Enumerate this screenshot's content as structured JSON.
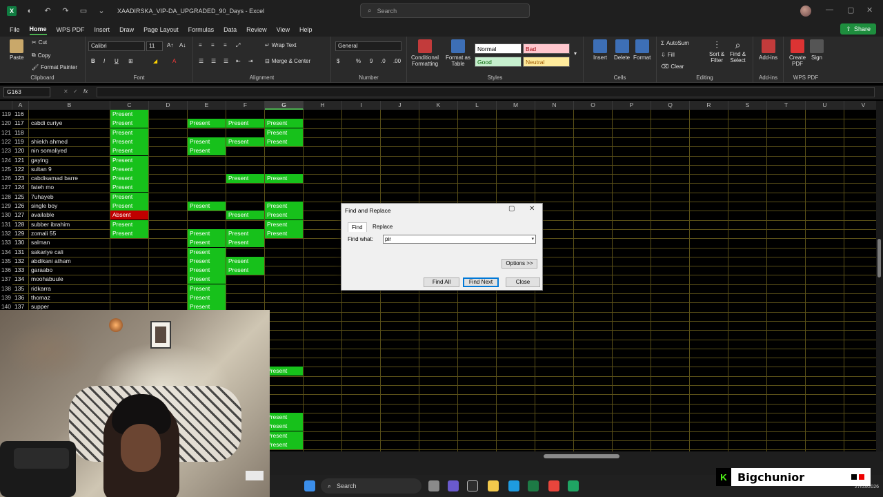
{
  "window": {
    "title": "XAADIRSKA_VIP-DA_UPGRADED_90_Days - Excel",
    "search_placeholder": "Search"
  },
  "menu": [
    "File",
    "Home",
    "WPS PDF",
    "Insert",
    "Draw",
    "Page Layout",
    "Formulas",
    "Data",
    "Review",
    "View",
    "Help"
  ],
  "active_menu": "Home",
  "share_label": "Share",
  "ribbon": {
    "clipboard": {
      "paste": "Paste",
      "cut": "Cut",
      "copy": "Copy",
      "format_painter": "Format Painter",
      "label": "Clipboard"
    },
    "font": {
      "name": "Calibri",
      "size": "11",
      "bold": "B",
      "italic": "I",
      "underline": "U",
      "label": "Font"
    },
    "alignment": {
      "wrap_text": "Wrap Text",
      "merge_center": "Merge & Center",
      "label": "Alignment"
    },
    "number": {
      "format": "General",
      "percent": "%",
      "comma": "9",
      "label": "Number"
    },
    "styles": {
      "conditional": [
        "Conditional",
        "Formatting"
      ],
      "format_as_table": [
        "Format as",
        "Table"
      ],
      "normal": "Normal",
      "bad": "Bad",
      "good": "Good",
      "neutral": "Neutral",
      "label": "Styles"
    },
    "cells": {
      "insert": "Insert",
      "delete": "Delete",
      "format": "Format",
      "label": "Cells"
    },
    "editing": {
      "autosum": "AutoSum",
      "fill": "Fill",
      "clear": "Clear",
      "sort_filter": [
        "Sort &",
        "Filter"
      ],
      "find_select": [
        "Find &",
        "Select"
      ],
      "label": "Editing"
    },
    "addins": {
      "addins": "Add-ins",
      "label": "Add-ins"
    },
    "wps": {
      "create_pdf": [
        "Create",
        "PDF"
      ],
      "sign": "Sign",
      "label": "WPS PDF"
    }
  },
  "formula_bar": {
    "name_box": "G163",
    "fx": "fx"
  },
  "columns": [
    "A",
    "B",
    "C",
    "D",
    "E",
    "F",
    "G",
    "H",
    "I",
    "J",
    "K",
    "L",
    "M",
    "N",
    "O",
    "P",
    "Q",
    "R",
    "S",
    "T",
    "U",
    "V"
  ],
  "selected_column": "G",
  "rows": [
    {
      "row": "119",
      "a": "116",
      "b": "",
      "c": "Present",
      "e": "",
      "f": "",
      "g": ""
    },
    {
      "row": "120",
      "a": "117",
      "b": "cabdi curiye",
      "c": "Present",
      "e": "Present",
      "f": "Present",
      "g": "Present"
    },
    {
      "row": "121",
      "a": "118",
      "b": "",
      "c": "Present",
      "e": "",
      "f": "",
      "g": "Present"
    },
    {
      "row": "122",
      "a": "119",
      "b": "shiekh ahmed",
      "c": "Present",
      "e": "Present",
      "f": "Present",
      "g": "Present"
    },
    {
      "row": "123",
      "a": "120",
      "b": "nin somaliyed",
      "c": "Present",
      "e": "Present",
      "f": "",
      "g": ""
    },
    {
      "row": "124",
      "a": "121",
      "b": "gaying",
      "c": "Present",
      "e": "",
      "f": "",
      "g": ""
    },
    {
      "row": "125",
      "a": "122",
      "b": "sultan 9",
      "c": "Present",
      "e": "",
      "f": "",
      "g": ""
    },
    {
      "row": "126",
      "a": "123",
      "b": "cabdisamad barre",
      "c": "Present",
      "e": "",
      "f": "Present",
      "g": "Present"
    },
    {
      "row": "127",
      "a": "124",
      "b": "fateh mo",
      "c": "Present",
      "e": "",
      "f": "",
      "g": ""
    },
    {
      "row": "128",
      "a": "125",
      "b": "7uhayeb",
      "c": "Present",
      "e": "",
      "f": "",
      "g": ""
    },
    {
      "row": "129",
      "a": "126",
      "b": "single boy",
      "c": "Present",
      "e": "Present",
      "f": "",
      "g": "Present"
    },
    {
      "row": "130",
      "a": "127",
      "b": "available",
      "c": "Absent",
      "e": "",
      "f": "Present",
      "g": "Present"
    },
    {
      "row": "131",
      "a": "128",
      "b": "subber ibrahim",
      "c": "Present",
      "e": "",
      "f": "",
      "g": "Present"
    },
    {
      "row": "132",
      "a": "129",
      "b": "zomali 55",
      "c": "Present",
      "e": "Present",
      "f": "Present",
      "g": "Present"
    },
    {
      "row": "133",
      "a": "130",
      "b": "salman",
      "c": "",
      "e": "Present",
      "f": "Present",
      "g": ""
    },
    {
      "row": "134",
      "a": "131",
      "b": "sakariye cali",
      "c": "",
      "e": "Present",
      "f": "",
      "g": ""
    },
    {
      "row": "135",
      "a": "132",
      "b": "abdikani atham",
      "c": "",
      "e": "Present",
      "f": "Present",
      "g": ""
    },
    {
      "row": "136",
      "a": "133",
      "b": "garaabo",
      "c": "",
      "e": "Present",
      "f": "Present",
      "g": ""
    },
    {
      "row": "137",
      "a": "134",
      "b": "moohabuule",
      "c": "",
      "e": "Present",
      "f": "",
      "g": ""
    },
    {
      "row": "138",
      "a": "135",
      "b": "ridkarra",
      "c": "",
      "e": "Present",
      "f": "",
      "g": ""
    },
    {
      "row": "139",
      "a": "136",
      "b": "thomaz",
      "c": "",
      "e": "Present",
      "f": "",
      "g": ""
    },
    {
      "row": "140",
      "a": "137",
      "b": "supper",
      "c": "",
      "e": "Present",
      "f": "",
      "g": ""
    }
  ],
  "lower_g_cells": [
    "Present",
    "Present",
    "Present",
    "Present",
    "Present"
  ],
  "dialog": {
    "title": "Find and Replace",
    "tab_find": "Find",
    "tab_replace": "Replace",
    "find_label": "Find what:",
    "find_value": "pir",
    "options": "Options >>",
    "find_all": "Find All",
    "find_next": "Find Next",
    "close": "Close"
  },
  "taskbar": {
    "search": "Search",
    "clock_date": "27/03/2026"
  },
  "streamer": {
    "badge_letter": "K",
    "name": "Bigchunior"
  },
  "colors": {
    "present": "#17c11b",
    "absent": "#c00000",
    "accent": "#107c41"
  }
}
